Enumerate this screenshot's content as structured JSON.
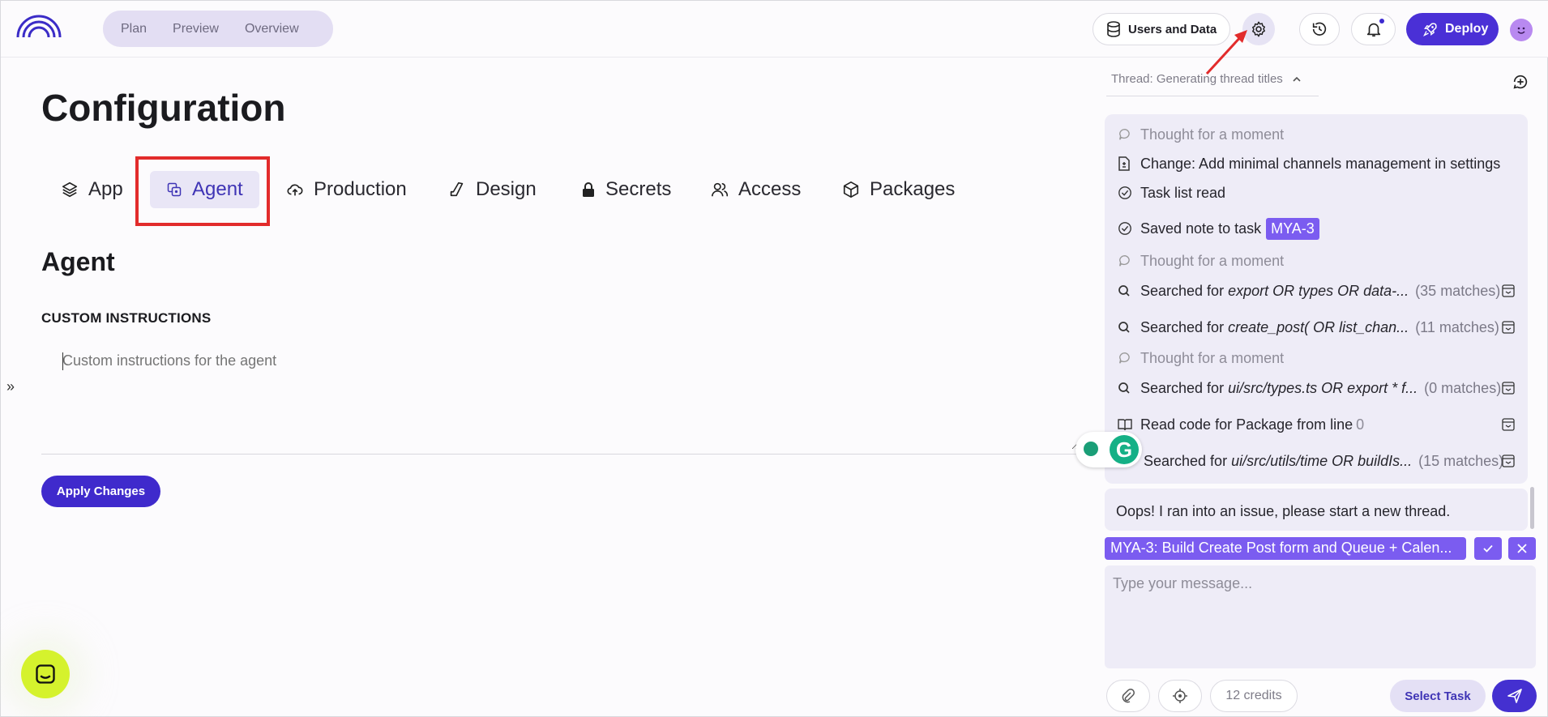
{
  "topbar": {
    "nav": [
      "Plan",
      "Preview",
      "Overview"
    ],
    "users_data_label": "Users and Data",
    "deploy_label": "Deploy"
  },
  "main": {
    "title": "Configuration",
    "tabs": [
      {
        "label": "App",
        "icon": "stack-icon"
      },
      {
        "label": "Agent",
        "icon": "agent-icon",
        "active": true
      },
      {
        "label": "Production",
        "icon": "cloud-icon"
      },
      {
        "label": "Design",
        "icon": "design-icon"
      },
      {
        "label": "Secrets",
        "icon": "lock-icon"
      },
      {
        "label": "Access",
        "icon": "users-icon"
      },
      {
        "label": "Packages",
        "icon": "package-icon"
      }
    ],
    "section_title": "Agent",
    "custom_instructions_label": "CUSTOM INSTRUCTIONS",
    "instructions_placeholder": "Custom instructions for the agent",
    "apply_label": "Apply Changes"
  },
  "panel": {
    "thread_title": "Thread: Generating thread titles",
    "activity": [
      {
        "type": "thought",
        "text": "Thought for a moment"
      },
      {
        "type": "change",
        "text": "Change: Add minimal channels management in settings"
      },
      {
        "type": "check",
        "text": "Task list read"
      },
      {
        "type": "check",
        "text": "Saved note to task",
        "tag": "MYA-3"
      },
      {
        "type": "thought",
        "text": "Thought for a moment"
      },
      {
        "type": "search",
        "prefix": "Searched for",
        "query": "export OR types OR data-...",
        "count": "(35 matches)"
      },
      {
        "type": "search",
        "prefix": "Searched for",
        "query": "create_post( OR list_chan...",
        "count": "(11 matches)"
      },
      {
        "type": "thought",
        "text": "Thought for a moment"
      },
      {
        "type": "search",
        "prefix": "Searched for",
        "query": "ui/src/types.ts OR export * f...",
        "count": "(0 matches)"
      },
      {
        "type": "read",
        "text": "Read code for Package from line",
        "num": "0"
      },
      {
        "type": "search",
        "prefix": "Searched for",
        "query": "ui/src/utils/time OR buildIs...",
        "count": "(15 matches)"
      }
    ],
    "error_text": "Oops! I ran into an issue, please start a new thread.",
    "task_chip": "MYA-3: Build Create Post form and Queue + Calen...",
    "composer_placeholder": "Type your message...",
    "credits": "12 credits",
    "select_task_label": "Select Task"
  },
  "colors": {
    "accent": "#4a30d6",
    "tag": "#7b5cf0",
    "annotation_red": "#e22b2b",
    "chat_bubble": "#d5f22d"
  }
}
